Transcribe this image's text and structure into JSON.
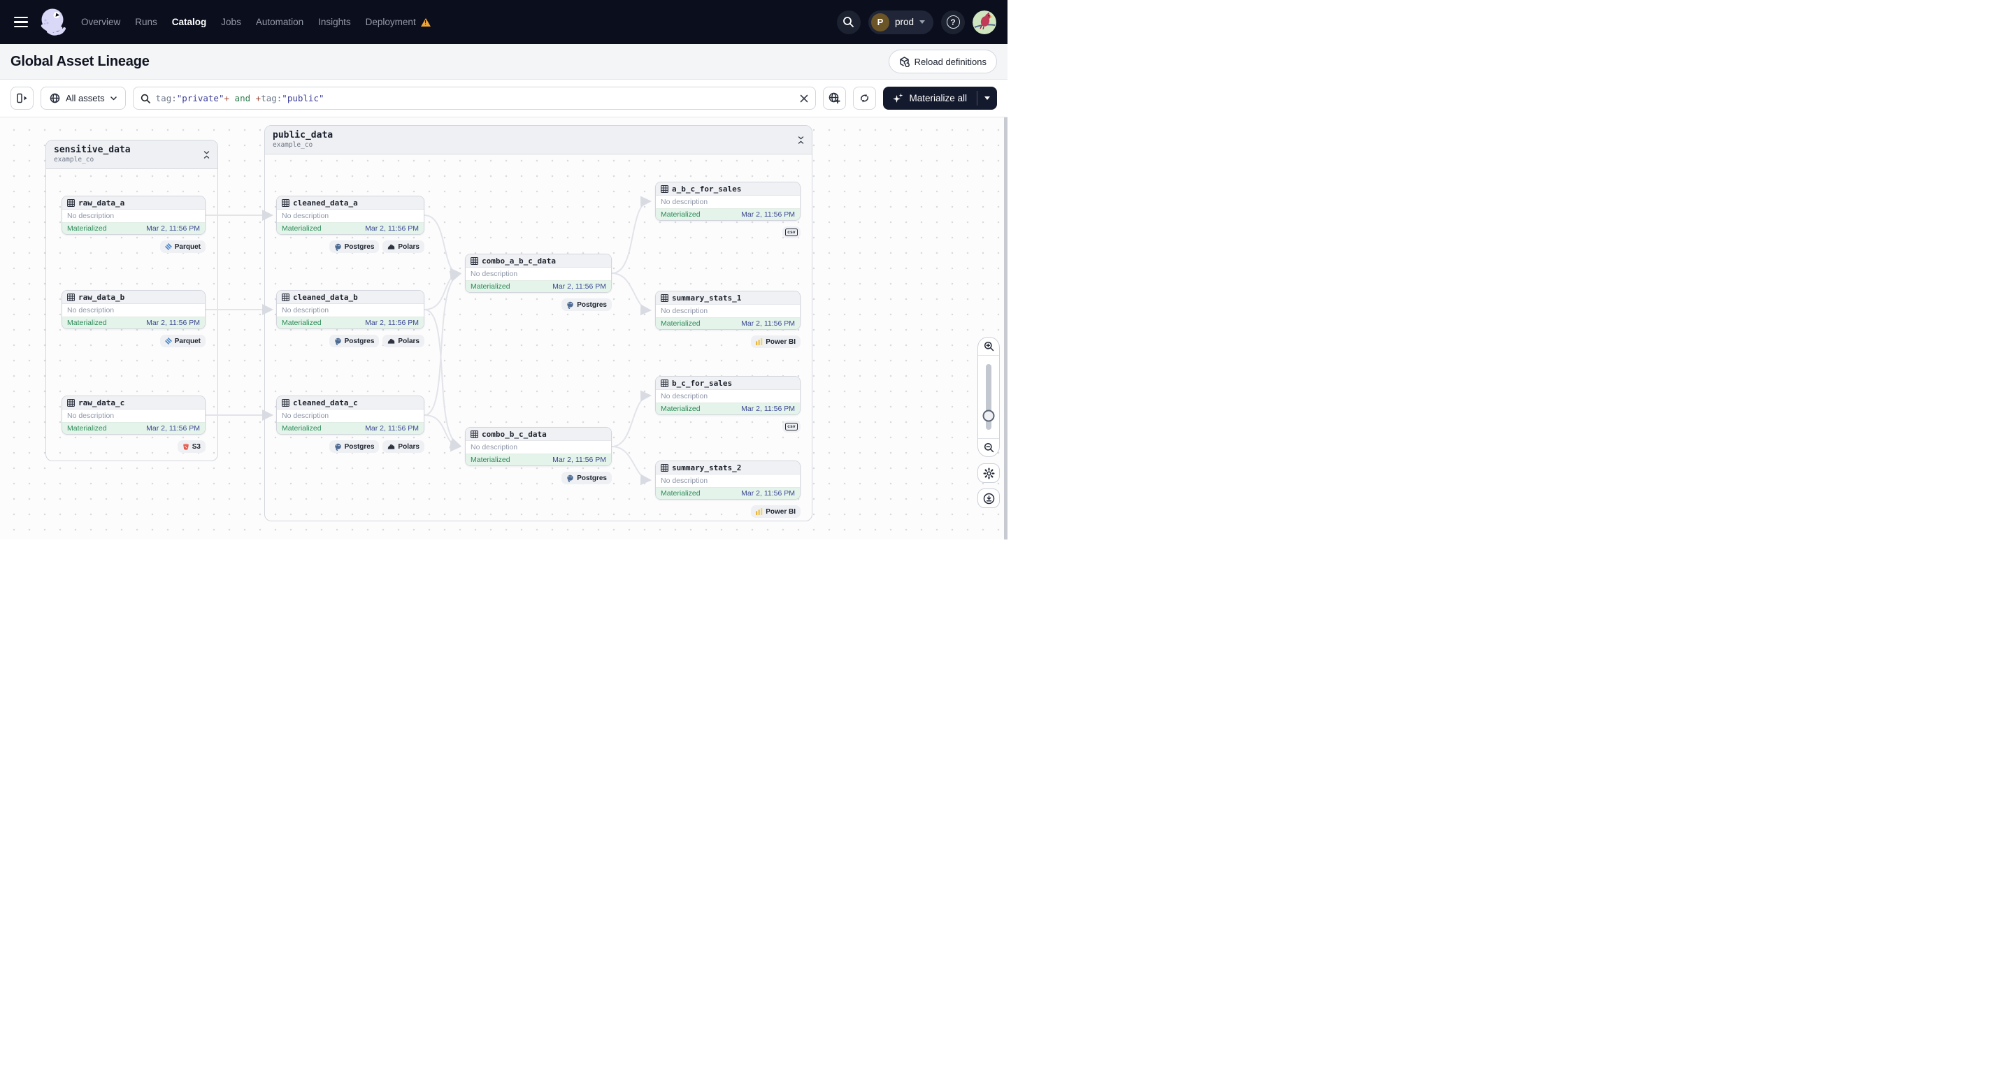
{
  "nav": {
    "items": [
      {
        "label": "Overview",
        "active": false
      },
      {
        "label": "Runs",
        "active": false
      },
      {
        "label": "Catalog",
        "active": true
      },
      {
        "label": "Jobs",
        "active": false
      },
      {
        "label": "Automation",
        "active": false
      },
      {
        "label": "Insights",
        "active": false
      },
      {
        "label": "Deployment",
        "active": false,
        "warning": true
      }
    ],
    "environment": {
      "initial": "P",
      "label": "prod"
    }
  },
  "header": {
    "title": "Global Asset Lineage",
    "reload_button_label": "Reload definitions"
  },
  "toolbar": {
    "scope_dropdown_label": "All assets",
    "search_query_full": "tag:\"private\"+ and +tag:\"public\"",
    "search_query_tokens": [
      {
        "text": "tag:",
        "type": "field"
      },
      {
        "text": "\"private\"",
        "type": "value"
      },
      {
        "text": "+",
        "type": "plus"
      },
      {
        "text": " and ",
        "type": "operator"
      },
      {
        "text": "+",
        "type": "plus"
      },
      {
        "text": "tag:",
        "type": "field"
      },
      {
        "text": "\"public\"",
        "type": "value"
      }
    ],
    "materialize_button_label": "Materialize all"
  },
  "colors": {
    "nav_bg": "#0b0e1d",
    "dark_button": "#141a2d",
    "status_green_bg": "#e4f4ea",
    "status_green_text": "#2c8a57",
    "timestamp_text": "#3d4793",
    "warning_orange": "#eda43a",
    "edge": "#e2e4e9",
    "powerbi_yellow": "#f2c140",
    "s3_red": "#e0584b",
    "parquet_blue": "#4f86c6"
  },
  "graph": {
    "groups": [
      {
        "title": "sensitive_data",
        "subtitle": "example_co"
      },
      {
        "title": "public_data",
        "subtitle": "example_co"
      }
    ],
    "nodes": [
      {
        "name": "raw_data_a",
        "description": "No description",
        "status": "Materialized",
        "timestamp": "Mar 2, 11:56 PM",
        "tags": [
          "Parquet"
        ]
      },
      {
        "name": "raw_data_b",
        "description": "No description",
        "status": "Materialized",
        "timestamp": "Mar 2, 11:56 PM",
        "tags": [
          "Parquet"
        ]
      },
      {
        "name": "raw_data_c",
        "description": "No description",
        "status": "Materialized",
        "timestamp": "Mar 2, 11:56 PM",
        "tags": [
          "S3"
        ]
      },
      {
        "name": "cleaned_data_a",
        "description": "No description",
        "status": "Materialized",
        "timestamp": "Mar 2, 11:56 PM",
        "tags": [
          "Postgres",
          "Polars"
        ]
      },
      {
        "name": "cleaned_data_b",
        "description": "No description",
        "status": "Materialized",
        "timestamp": "Mar 2, 11:56 PM",
        "tags": [
          "Postgres",
          "Polars"
        ]
      },
      {
        "name": "cleaned_data_c",
        "description": "No description",
        "status": "Materialized",
        "timestamp": "Mar 2, 11:56 PM",
        "tags": [
          "Postgres",
          "Polars"
        ]
      },
      {
        "name": "combo_a_b_c_data",
        "description": "No description",
        "status": "Materialized",
        "timestamp": "Mar 2, 11:56 PM",
        "tags": [
          "Postgres"
        ]
      },
      {
        "name": "combo_b_c_data",
        "description": "No description",
        "status": "Materialized",
        "timestamp": "Mar 2, 11:56 PM",
        "tags": [
          "Postgres"
        ]
      },
      {
        "name": "a_b_c_for_sales",
        "description": "No description",
        "status": "Materialized",
        "timestamp": "Mar 2, 11:56 PM",
        "tags": [
          "csv"
        ]
      },
      {
        "name": "summary_stats_1",
        "description": "No description",
        "status": "Materialized",
        "timestamp": "Mar 2, 11:56 PM",
        "tags": [
          "Power BI"
        ]
      },
      {
        "name": "b_c_for_sales",
        "description": "No description",
        "status": "Materialized",
        "timestamp": "Mar 2, 11:56 PM",
        "tags": [
          "csv"
        ]
      },
      {
        "name": "summary_stats_2",
        "description": "No description",
        "status": "Materialized",
        "timestamp": "Mar 2, 11:56 PM",
        "tags": [
          "Power BI"
        ]
      }
    ]
  }
}
